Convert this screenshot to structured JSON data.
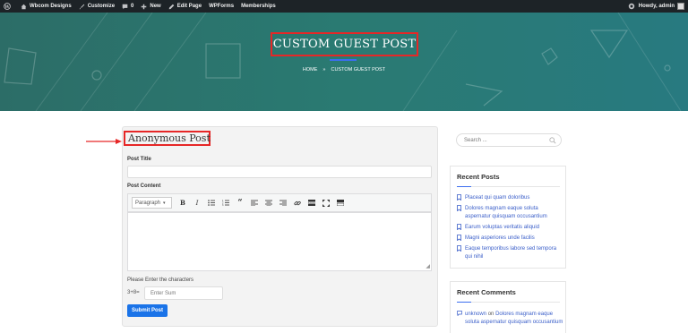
{
  "adminbar": {
    "site_name": "Wbcom Designs",
    "customize": "Customize",
    "comments_count": "0",
    "new": "New",
    "edit_page": "Edit Page",
    "wpforms": "WPForms",
    "memberships": "Memberships",
    "howdy": "Howdy, admin"
  },
  "hero": {
    "title": "CUSTOM GUEST POST",
    "breadcrumb_home": "HOME",
    "breadcrumb_sep": "»",
    "breadcrumb_current": "CUSTOM GUEST POST"
  },
  "form": {
    "heading": "Anonymous Post",
    "post_title_label": "Post Title",
    "post_title_value": "",
    "post_content_label": "Post Content",
    "format_select": "Paragraph",
    "captcha_label": "Please Enter the characters",
    "captcha_question": "3+8=",
    "captcha_placeholder": "Enter Sum",
    "submit_label": "Submit Post"
  },
  "sidebar": {
    "search_placeholder": "Search ...",
    "recent_posts_title": "Recent Posts",
    "recent_posts": [
      "Placeat qui quam doloribus",
      "Dolores magnam eaque soluta aspernatur quisquam occusantium",
      "Earum voluptas veritatis aliquid",
      "Magni asperiores unde facilis",
      "Eaque temporibus labore sed tempora qui nihil"
    ],
    "recent_comments_title": "Recent Comments",
    "comment_author": "unknown",
    "comment_on": "on",
    "comment_post": "Dolores magnam eaque soluta aspernatur quisquam occusantium"
  },
  "colors": {
    "accent": "#3c6ef0",
    "annotation_red": "#e62727",
    "submit_blue": "#1a73e8",
    "hero_teal": "#2a7a72"
  }
}
